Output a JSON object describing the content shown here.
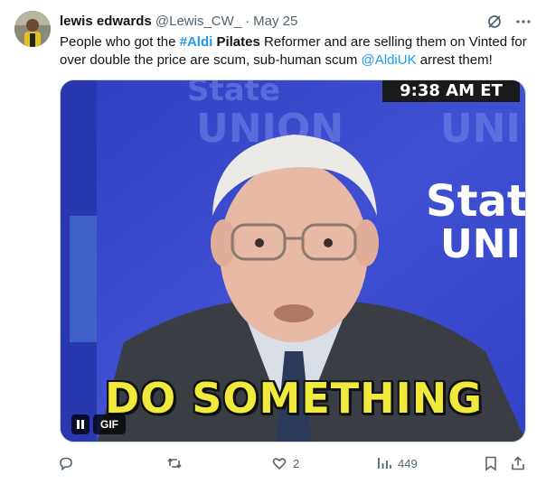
{
  "tweet": {
    "display_name": "lewis edwards",
    "handle": "@Lewis_CW_",
    "separator": "·",
    "date": "May 25",
    "text": {
      "part1": "People who got the ",
      "hashtag": "#Aldi",
      "bold_word": " Pilates",
      "part2": " Reformer and are selling them on Vinted for over double the price are scum, sub-human scum ",
      "mention": "@AldiUK",
      "part3": " arrest them!"
    },
    "media": {
      "time_chip": "9:38 AM ET",
      "caption": "DO SOMETHING",
      "badge": "GIF",
      "background_words": [
        "State",
        "UNION",
        "State",
        "UNI"
      ]
    },
    "actions": {
      "replies": "",
      "reposts": "",
      "likes": "2",
      "views": "449"
    }
  },
  "colors": {
    "accent": "#1d9bf0",
    "caption_yellow": "#f1ea3c",
    "backdrop_blue": "#3c4ec9"
  }
}
